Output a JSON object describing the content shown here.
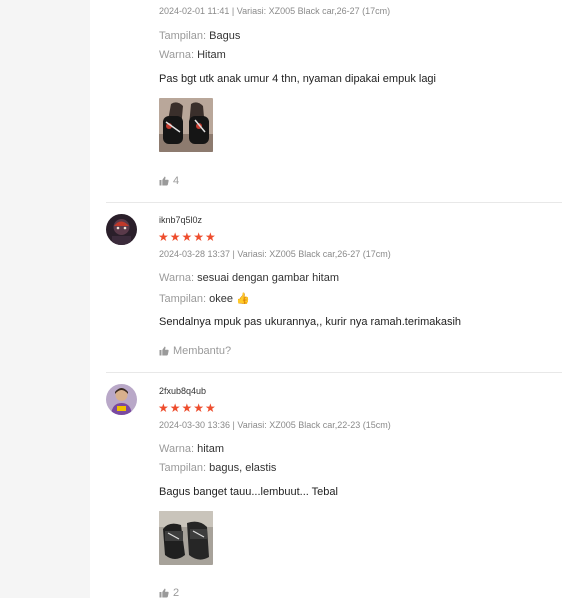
{
  "reviews": [
    {
      "meta": "2024-02-01 11:41 | Variasi: XZ005 Black car,26-27 (17cm)",
      "attrs": [
        {
          "label": "Tampilan:",
          "value": "Bagus"
        },
        {
          "label": "Warna:",
          "value": "Hitam"
        }
      ],
      "text": "Pas bgt utk anak umur 4 thn, nyaman dipakai empuk lagi",
      "likes": "4"
    },
    {
      "username": "iknb7q5l0z",
      "stars": "★★★★★",
      "meta": "2024-03-28 13:37 | Variasi: XZ005 Black car,26-27 (17cm)",
      "attrs": [
        {
          "label": "Warna:",
          "value": "sesuai dengan gambar hitam"
        },
        {
          "label": "Tampilan:",
          "value": "okee 👍"
        }
      ],
      "text": "Sendalnya mpuk pas ukurannya,, kurir nya ramah.terimakasih",
      "likes": "Membantu?"
    },
    {
      "username": "2fxub8q4ub",
      "stars": "★★★★★",
      "meta": "2024-03-30 13:36 | Variasi: XZ005 Black car,22-23 (15cm)",
      "attrs": [
        {
          "label": "Warna:",
          "value": "hitam"
        },
        {
          "label": "Tampilan:",
          "value": "bagus, elastis"
        }
      ],
      "text": "Bagus banget tauu...lembuut... Tebal",
      "likes": "2"
    }
  ],
  "colors": {
    "star": "#ee4d2d",
    "muted": "#8a8a8a",
    "gutter": "#f5f5f5"
  },
  "icons": {
    "like": "thumb-up-icon",
    "emoji": "thumbs-up-emoji"
  }
}
